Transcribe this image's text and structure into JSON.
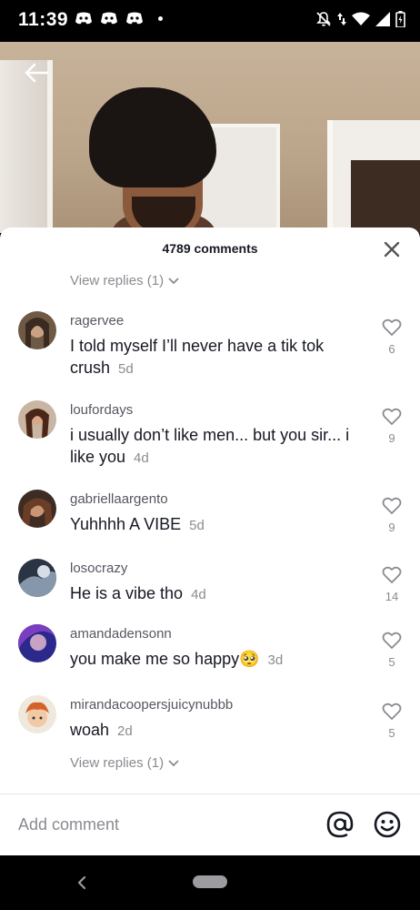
{
  "status_bar": {
    "time": "11:39",
    "notification_icons": [
      "discord-icon",
      "discord-icon",
      "discord-icon"
    ],
    "system_icons": [
      "bell-muted-icon",
      "data-arrows-icon",
      "wifi-icon",
      "cell-signal-icon",
      "battery-icon"
    ]
  },
  "video": {
    "back_icon": "arrow-left-icon"
  },
  "sheet": {
    "comments_count": "4789 comments",
    "view_replies_top": "View replies (1)",
    "view_replies_bottom": "View replies (1)",
    "comments": [
      {
        "username": "ragervee",
        "text": "I told myself I’ll never have a tik tok crush",
        "time": "5d",
        "likes": "6",
        "avatar_color": "#5b4a3a"
      },
      {
        "username": "loufordays",
        "text": "i usually don’t like men... but you sir... i like you",
        "time": "4d",
        "likes": "9",
        "avatar_color": "#6b3b30"
      },
      {
        "username": "gabriellaargento",
        "text": "Yuhhhh A VIBE",
        "time": "5d",
        "likes": "9",
        "avatar_color": "#7a5240"
      },
      {
        "username": "losocrazy",
        "text": "He is a vibe tho",
        "time": "4d",
        "likes": "14",
        "avatar_color": "#6d7a8c"
      },
      {
        "username": "amandadensonn",
        "text": "you make me so happy🥺",
        "time": "3d",
        "likes": "5",
        "avatar_color": "#3b2f8a"
      },
      {
        "username": "mirandacoopersjuicynubbb",
        "text": "woah",
        "time": "2d",
        "likes": "5",
        "avatar_color": "#e8e1d8"
      }
    ]
  },
  "input_bar": {
    "placeholder": "Add comment",
    "mention_icon": "at-sign-icon",
    "emoji_icon": "smiley-icon"
  },
  "nav_bar": {
    "back_icon": "chevron-left-icon",
    "home_icon": "home-pill-icon"
  },
  "colors": {
    "text_primary": "#161823",
    "text_secondary": "#8a8b91",
    "username": "#555761"
  }
}
